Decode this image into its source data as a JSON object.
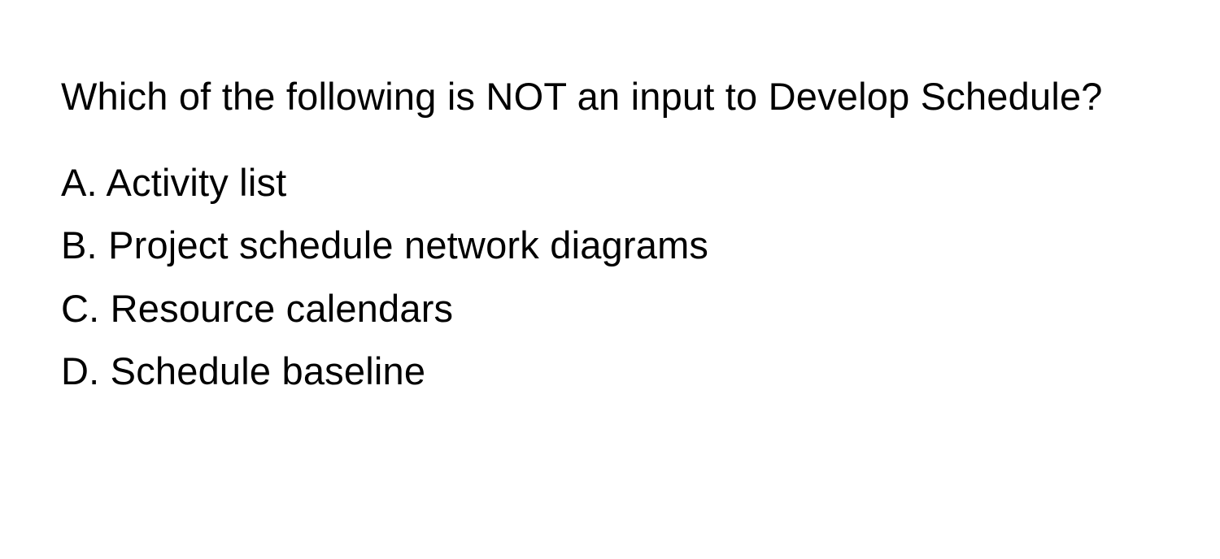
{
  "question": "Which of the following is NOT an input to Develop Schedule?",
  "options": {
    "a": "A. Activity list",
    "b": "B. Project schedule network diagrams",
    "c": "C. Resource calendars",
    "d": "D. Schedule baseline"
  }
}
